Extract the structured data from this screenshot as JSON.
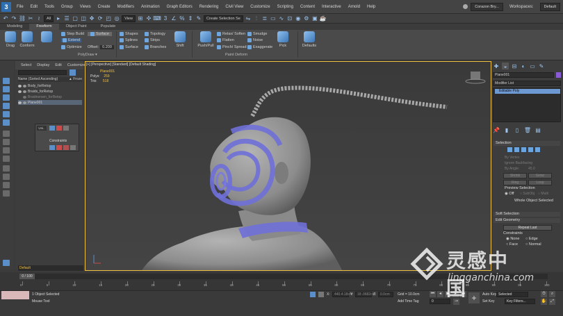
{
  "menu": {
    "items": [
      "File",
      "Edit",
      "Tools",
      "Group",
      "Views",
      "Create",
      "Modifiers",
      "Animation",
      "Graph Editors",
      "Rendering",
      "Civil View",
      "Customize",
      "Scripting",
      "Content",
      "Interactive",
      "Arnold",
      "Help"
    ],
    "user": "Corazon Bry...",
    "workspaces_label": "Workspaces:",
    "workspace": "Default"
  },
  "toolbar": {
    "filter": "All",
    "refcoord": "View",
    "selection_set": "Create Selection Se"
  },
  "ribbon": {
    "tabs": [
      "Modeling",
      "Freeform",
      "Object Paint",
      "Populate"
    ],
    "active_tab": "Freeform",
    "drag": "Drag",
    "conform": "Conform",
    "step_build": "Step Build",
    "extend": "Extend",
    "optimize": "Optimize",
    "surface": "Surface",
    "offset_label": "Offset:",
    "offset_value": "0.200",
    "shapes": "Shapes",
    "splines": "Splines",
    "surface2": "Surface",
    "topology": "Topology",
    "strips": "Strips",
    "branches": "Branches",
    "shift": "Shift",
    "push_pull": "Push/Pull",
    "relax_soften": "Relax/ Soften",
    "flatten": "Flatten",
    "pinch_spread": "Pinch/ Spread",
    "smudge": "Smudge",
    "noise": "Noise",
    "exaggerate": "Exaggerate",
    "pick": "Pick",
    "defaults": "Defaults",
    "polydraw": "PolyDraw ▾",
    "paint_deform": "Paint Deform"
  },
  "scene": {
    "menu": [
      "Select",
      "Display",
      "Edit",
      "Customize"
    ],
    "header": "Name (Sorted Ascending)",
    "frozen": "▲ Froze",
    "rows": [
      "Body_forRetop",
      "Braids_forRetop",
      "Braidnersen_forRetop",
      "Plane001"
    ],
    "layer": "Default",
    "constraints": "Constraints"
  },
  "viewport": {
    "label": "[+] [Perspective] [Standard] [Default Shading]",
    "object": "Plane001",
    "polys_label": "Polys:",
    "polys": "259",
    "tris_label": "Tris:",
    "tris": "518"
  },
  "cmd": {
    "object_name": "Plane001",
    "modifier_list": "Modifier List",
    "stack_item": "Editable Poly",
    "selection": "Selection",
    "by_vertex": "By Vertex",
    "ignore_backfacing": "Ignore Backfacing",
    "by_angle": "By Angle:",
    "by_angle_val": "45.0",
    "shrink": "Shrink",
    "grow": "Grow",
    "ring": "Ring",
    "loop": "Loop",
    "preview_selection": "Preview Selection",
    "off": "Off",
    "subobj": "SubObj",
    "multi": "Multi",
    "whole_selected": "Whole Object Selected",
    "soft_selection": "Soft Selection",
    "edit_geometry": "Edit Geometry",
    "repeat_last": "Repeat Last",
    "constraints": "Constraints",
    "none": "None",
    "edge": "Edge",
    "face": "Face",
    "normal": "Normal"
  },
  "timeline": {
    "frame": "0 / 100",
    "ticks": [
      "0",
      "5",
      "10",
      "15",
      "20",
      "25",
      "30",
      "35",
      "40",
      "45",
      "50",
      "55",
      "60",
      "65",
      "70",
      "75",
      "80",
      "85",
      "90",
      "95",
      "100"
    ]
  },
  "status": {
    "selected": "1 Object Selected",
    "hint": "Mouse Tool",
    "x_label": "X:",
    "x_val": "440.4.18cm",
    "y_label": "Y:",
    "y_val": "18 .0682cm",
    "z_label": "Z:",
    "z_val": "0.0cm",
    "grid": "Grid = 10.0cm",
    "add_time_tag": "Add Time Tag",
    "auto_key": "Auto Key",
    "selected_mode": "Selected",
    "set_key": "Set Key",
    "key_filters": "Key Filters..."
  },
  "watermark": {
    "cn": "灵感中国",
    "url": "lingganchina.com"
  },
  "colors": {
    "accent": "#5b8fc9",
    "highlight": "#f0c040",
    "poly_blue": "#6f6fd8"
  }
}
